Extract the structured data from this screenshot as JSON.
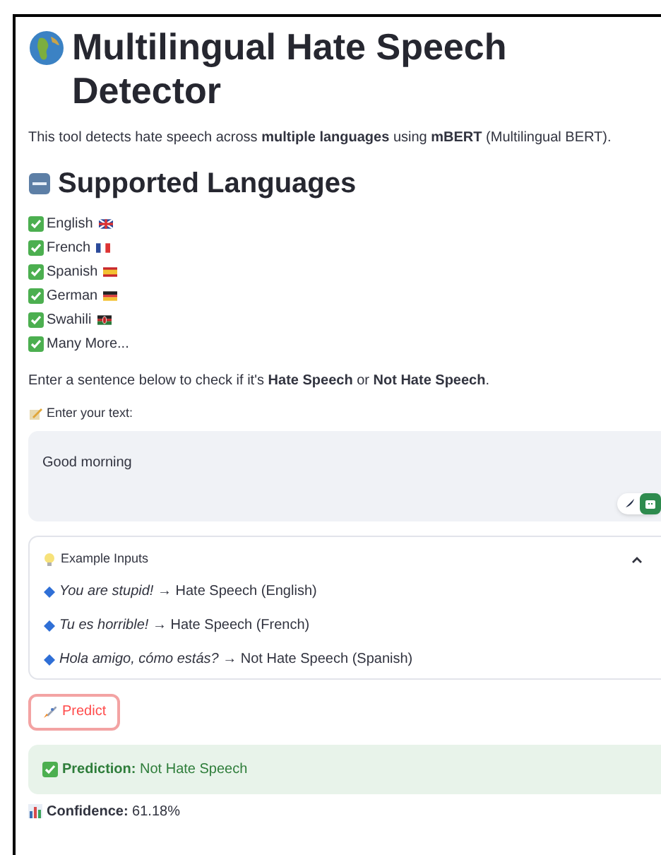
{
  "title": "Multilingual Hate Speech Detector",
  "intro": "This tool detects hate speech across **multiple languages** using **mBERT** (Multilingual BERT).",
  "languages_heading": "Supported Languages",
  "languages": [
    {
      "label": "English",
      "kind": "uk"
    },
    {
      "label": "French",
      "kind": "fr"
    },
    {
      "label": "Spanish",
      "kind": "es"
    },
    {
      "label": "German",
      "kind": "de"
    },
    {
      "label": "Swahili",
      "kind": "ke"
    },
    {
      "label": "Many More...",
      "kind": "none"
    }
  ],
  "prompt": "Enter a sentence below to check if it's **Hate Speech** or **Not Hate Speech**.",
  "input": {
    "label": "Enter your text:",
    "value": "Good morning"
  },
  "examples": {
    "title": "Example Inputs",
    "expanded": true,
    "items": [
      "*You are stupid!* → Hate Speech (English)",
      "*Tu es horrible!* → Hate Speech (French)",
      "*Hola amigo, cómo estás?* → Not Hate Speech (Spanish)"
    ]
  },
  "predict_button": "Predict",
  "prediction": "**Prediction:** Not Hate Speech",
  "confidence": "**Confidence:** 61.18%"
}
